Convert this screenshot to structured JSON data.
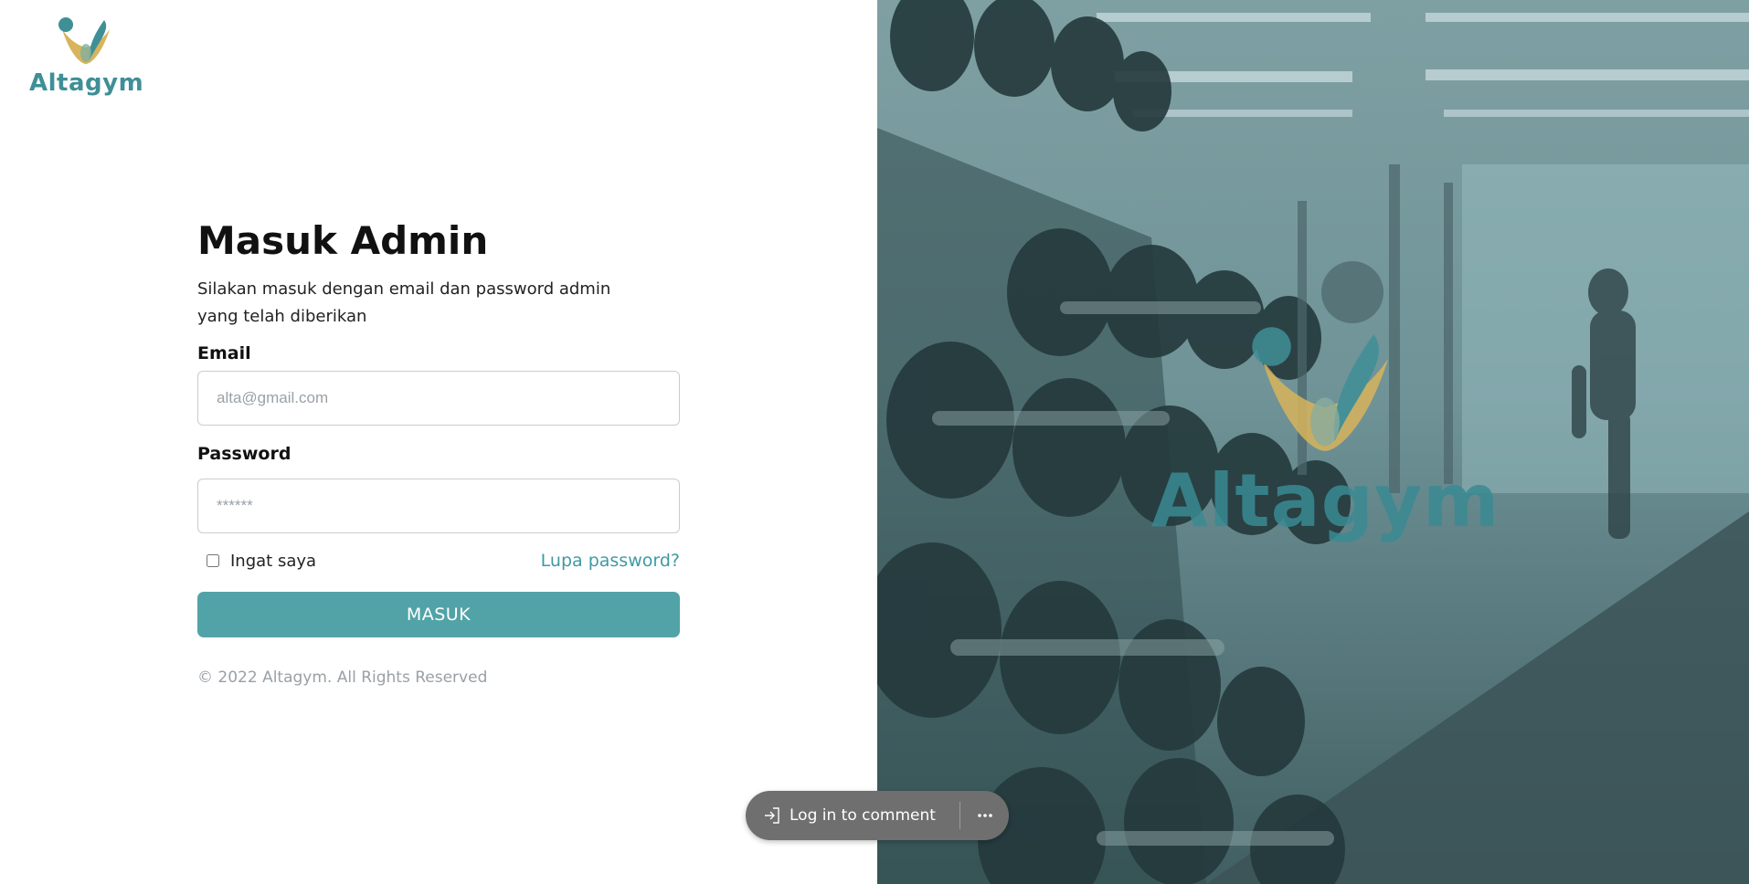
{
  "brand": {
    "name": "Altagym"
  },
  "form": {
    "title": "Masuk Admin",
    "subtitle": "Silakan masuk dengan email dan password admin yang telah diberikan",
    "email_label": "Email",
    "email_placeholder": "alta@gmail.com",
    "password_label": "Password",
    "password_placeholder": "******",
    "remember_label": "Ingat saya",
    "forgot_label": "Lupa password?",
    "submit_label": "MASUK",
    "copyright": "© 2022 Altagym. All Rights Reserved"
  },
  "hero": {
    "watermark_name": "Altagym"
  },
  "comment_bar": {
    "login_label": "Log in to comment"
  },
  "colors": {
    "accent": "#52a3a7",
    "brand_teal": "#3f8f97",
    "brand_gold": "#d8b45c"
  },
  "icons": [
    "altagym-logo-icon",
    "sign-in-icon",
    "more-icon"
  ]
}
